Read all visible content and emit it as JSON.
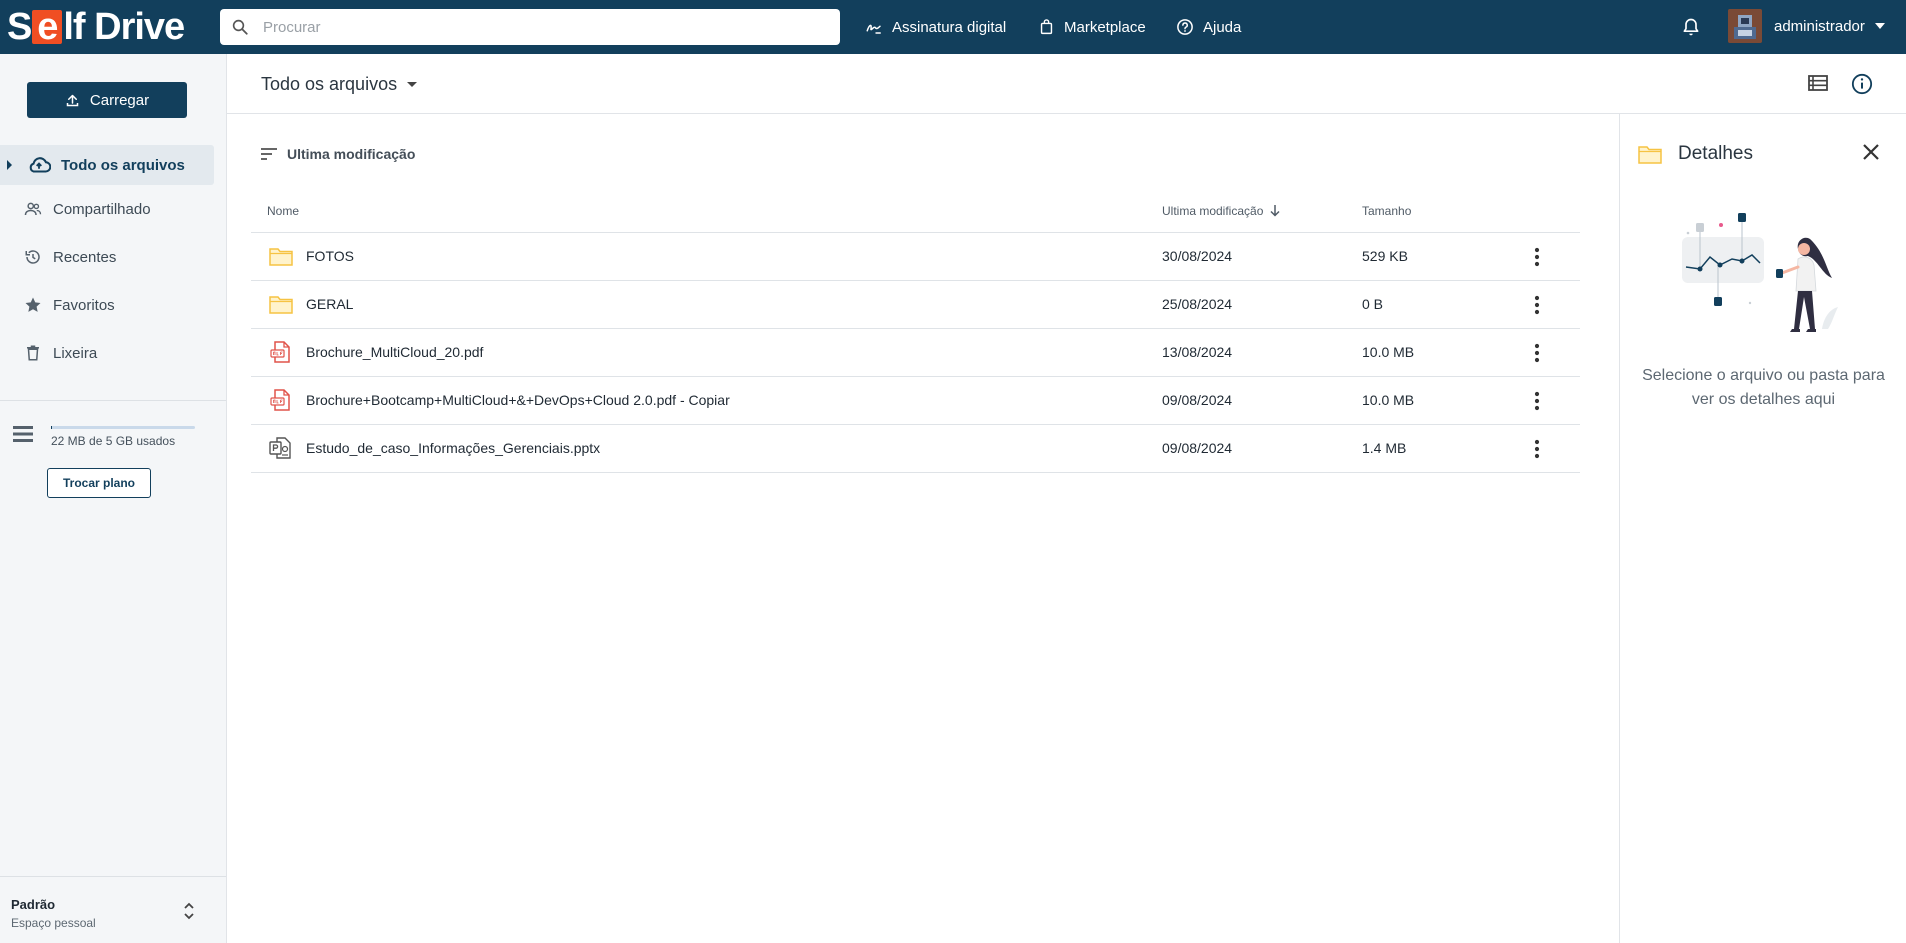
{
  "app": {
    "logo_pre": "S",
    "logo_e": "e",
    "logo_post": "lf Drive"
  },
  "search": {
    "placeholder": "Procurar"
  },
  "topnav": {
    "signature": "Assinatura digital",
    "marketplace": "Marketplace",
    "help": "Ajuda",
    "username": "administrador"
  },
  "sidebar": {
    "upload": "Carregar",
    "items": [
      {
        "label": "Todo os arquivos",
        "icon": "cloud-upload-icon",
        "active": true
      },
      {
        "label": "Compartilhado",
        "icon": "people-icon"
      },
      {
        "label": "Recentes",
        "icon": "history-icon"
      },
      {
        "label": "Favoritos",
        "icon": "star-icon"
      },
      {
        "label": "Lixeira",
        "icon": "trash-icon"
      }
    ],
    "storage_text": "22 MB de 5 GB usados",
    "storage_used_fraction": 0.0044,
    "plan_button": "Trocar plano",
    "space_title": "Padrão",
    "space_subtitle": "Espaço pessoal"
  },
  "main": {
    "folder_title": "Todo os arquivos",
    "sort_label": "Ultima modificação",
    "columns": {
      "name": "Nome",
      "modified": "Ultima modificação",
      "size": "Tamanho"
    },
    "rows": [
      {
        "name": "FOTOS",
        "type": "folder",
        "date": "30/08/2024",
        "size": "529 KB"
      },
      {
        "name": "GERAL",
        "type": "folder",
        "date": "25/08/2024",
        "size": "0 B"
      },
      {
        "name": "Brochure_MultiCloud_20.pdf",
        "type": "pdf",
        "date": "13/08/2024",
        "size": "10.0 MB"
      },
      {
        "name": "Brochure+Bootcamp+MultiCloud+&+DevOps+Cloud 2.0.pdf - Copiar",
        "type": "pdf",
        "date": "09/08/2024",
        "size": "10.0 MB"
      },
      {
        "name": "Estudo_de_caso_Informações_Gerenciais.pptx",
        "type": "pptx",
        "date": "09/08/2024",
        "size": "1.4 MB"
      }
    ]
  },
  "details": {
    "title": "Detalhes",
    "message": "Selecione o arquivo ou pasta para ver os detalhes aqui"
  },
  "colors": {
    "primary": "#123f5c",
    "logo_accent": "#f04e23",
    "folder": "#f6c343",
    "pdf": "#e0534a"
  }
}
